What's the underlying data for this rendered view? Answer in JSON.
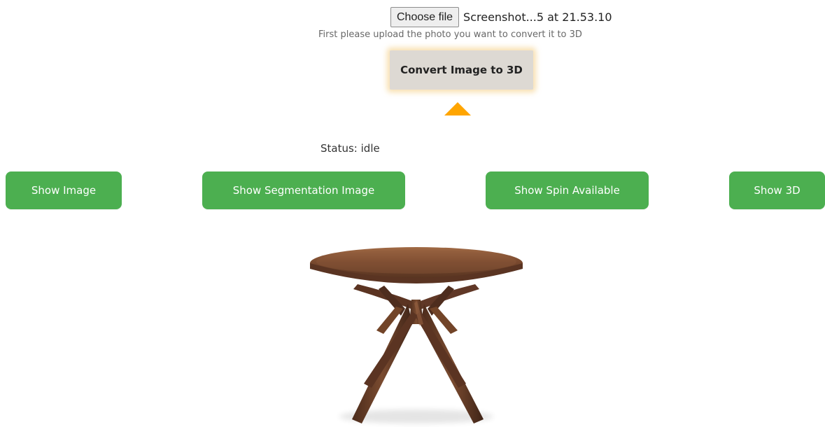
{
  "upload": {
    "choose_file_label": "Choose file",
    "selected_file": "Screenshot...5 at 21.53.10",
    "instructions": "First please upload the photo you want to convert it to 3D"
  },
  "actions": {
    "convert_label": "Convert Image to 3D",
    "status_label": "Status:",
    "status_value": "idle",
    "show_image_label": "Show Image",
    "show_segmentation_label": "Show Segmentation Image",
    "show_spin_label": "Show Spin Available",
    "show_3d_label": "Show 3D"
  },
  "colors": {
    "primary_button": "#4caf50",
    "convert_button": "#ddd9d3",
    "marker": "#ffa500",
    "table_wood": "#6b3f25"
  },
  "preview": {
    "image_subject": "round wooden table"
  }
}
